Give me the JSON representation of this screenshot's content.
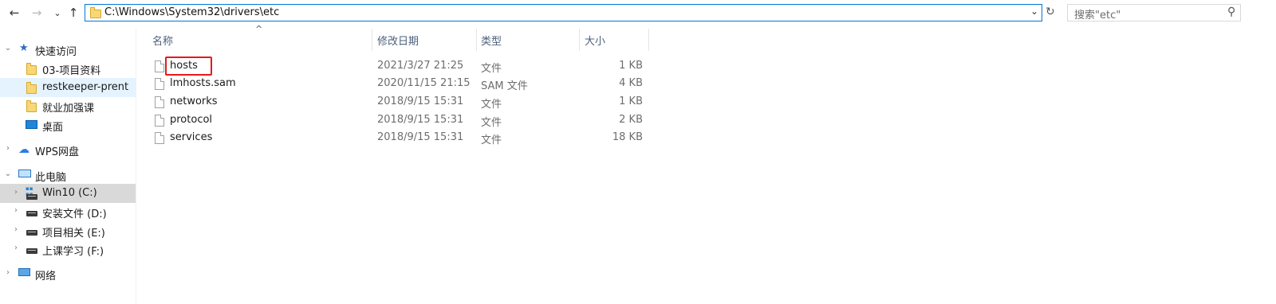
{
  "toolbar": {
    "back_icon": "←",
    "forward_icon": "→",
    "recent_icon": "⌄",
    "up_icon": "↑",
    "address_path": "C:\\Windows\\System32\\drivers\\etc",
    "dropdown_icon": "⌄",
    "refresh_icon": "↻",
    "search_placeholder": "搜索\"etc\"",
    "search_icon": "⚲"
  },
  "columns": {
    "name": "名称",
    "modified": "修改日期",
    "type": "类型",
    "size": "大小",
    "sort_indicator": "^"
  },
  "sidebar": {
    "quick_access": "快速访问",
    "quick_items": [
      "03-项目资料",
      "restkeeper-prent",
      "就业加强课",
      "桌面"
    ],
    "wps": "WPS网盘",
    "this_pc": "此电脑",
    "drives": [
      "Win10 (C:)",
      "安装文件 (D:)",
      "项目相关 (E:)",
      "上课学习 (F:)"
    ],
    "network": "网络"
  },
  "files": [
    {
      "name": "hosts",
      "modified": "2021/3/27 21:25",
      "type": "文件",
      "size": "1 KB"
    },
    {
      "name": "lmhosts.sam",
      "modified": "2020/11/15 21:15",
      "type": "SAM 文件",
      "size": "4 KB"
    },
    {
      "name": "networks",
      "modified": "2018/9/15 15:31",
      "type": "文件",
      "size": "1 KB"
    },
    {
      "name": "protocol",
      "modified": "2018/9/15 15:31",
      "type": "文件",
      "size": "2 KB"
    },
    {
      "name": "services",
      "modified": "2018/9/15 15:31",
      "type": "文件",
      "size": "18 KB"
    }
  ],
  "colors": {
    "accent": "#0078d7",
    "highlight_box": "#e81818",
    "folder": "#f8d775"
  }
}
